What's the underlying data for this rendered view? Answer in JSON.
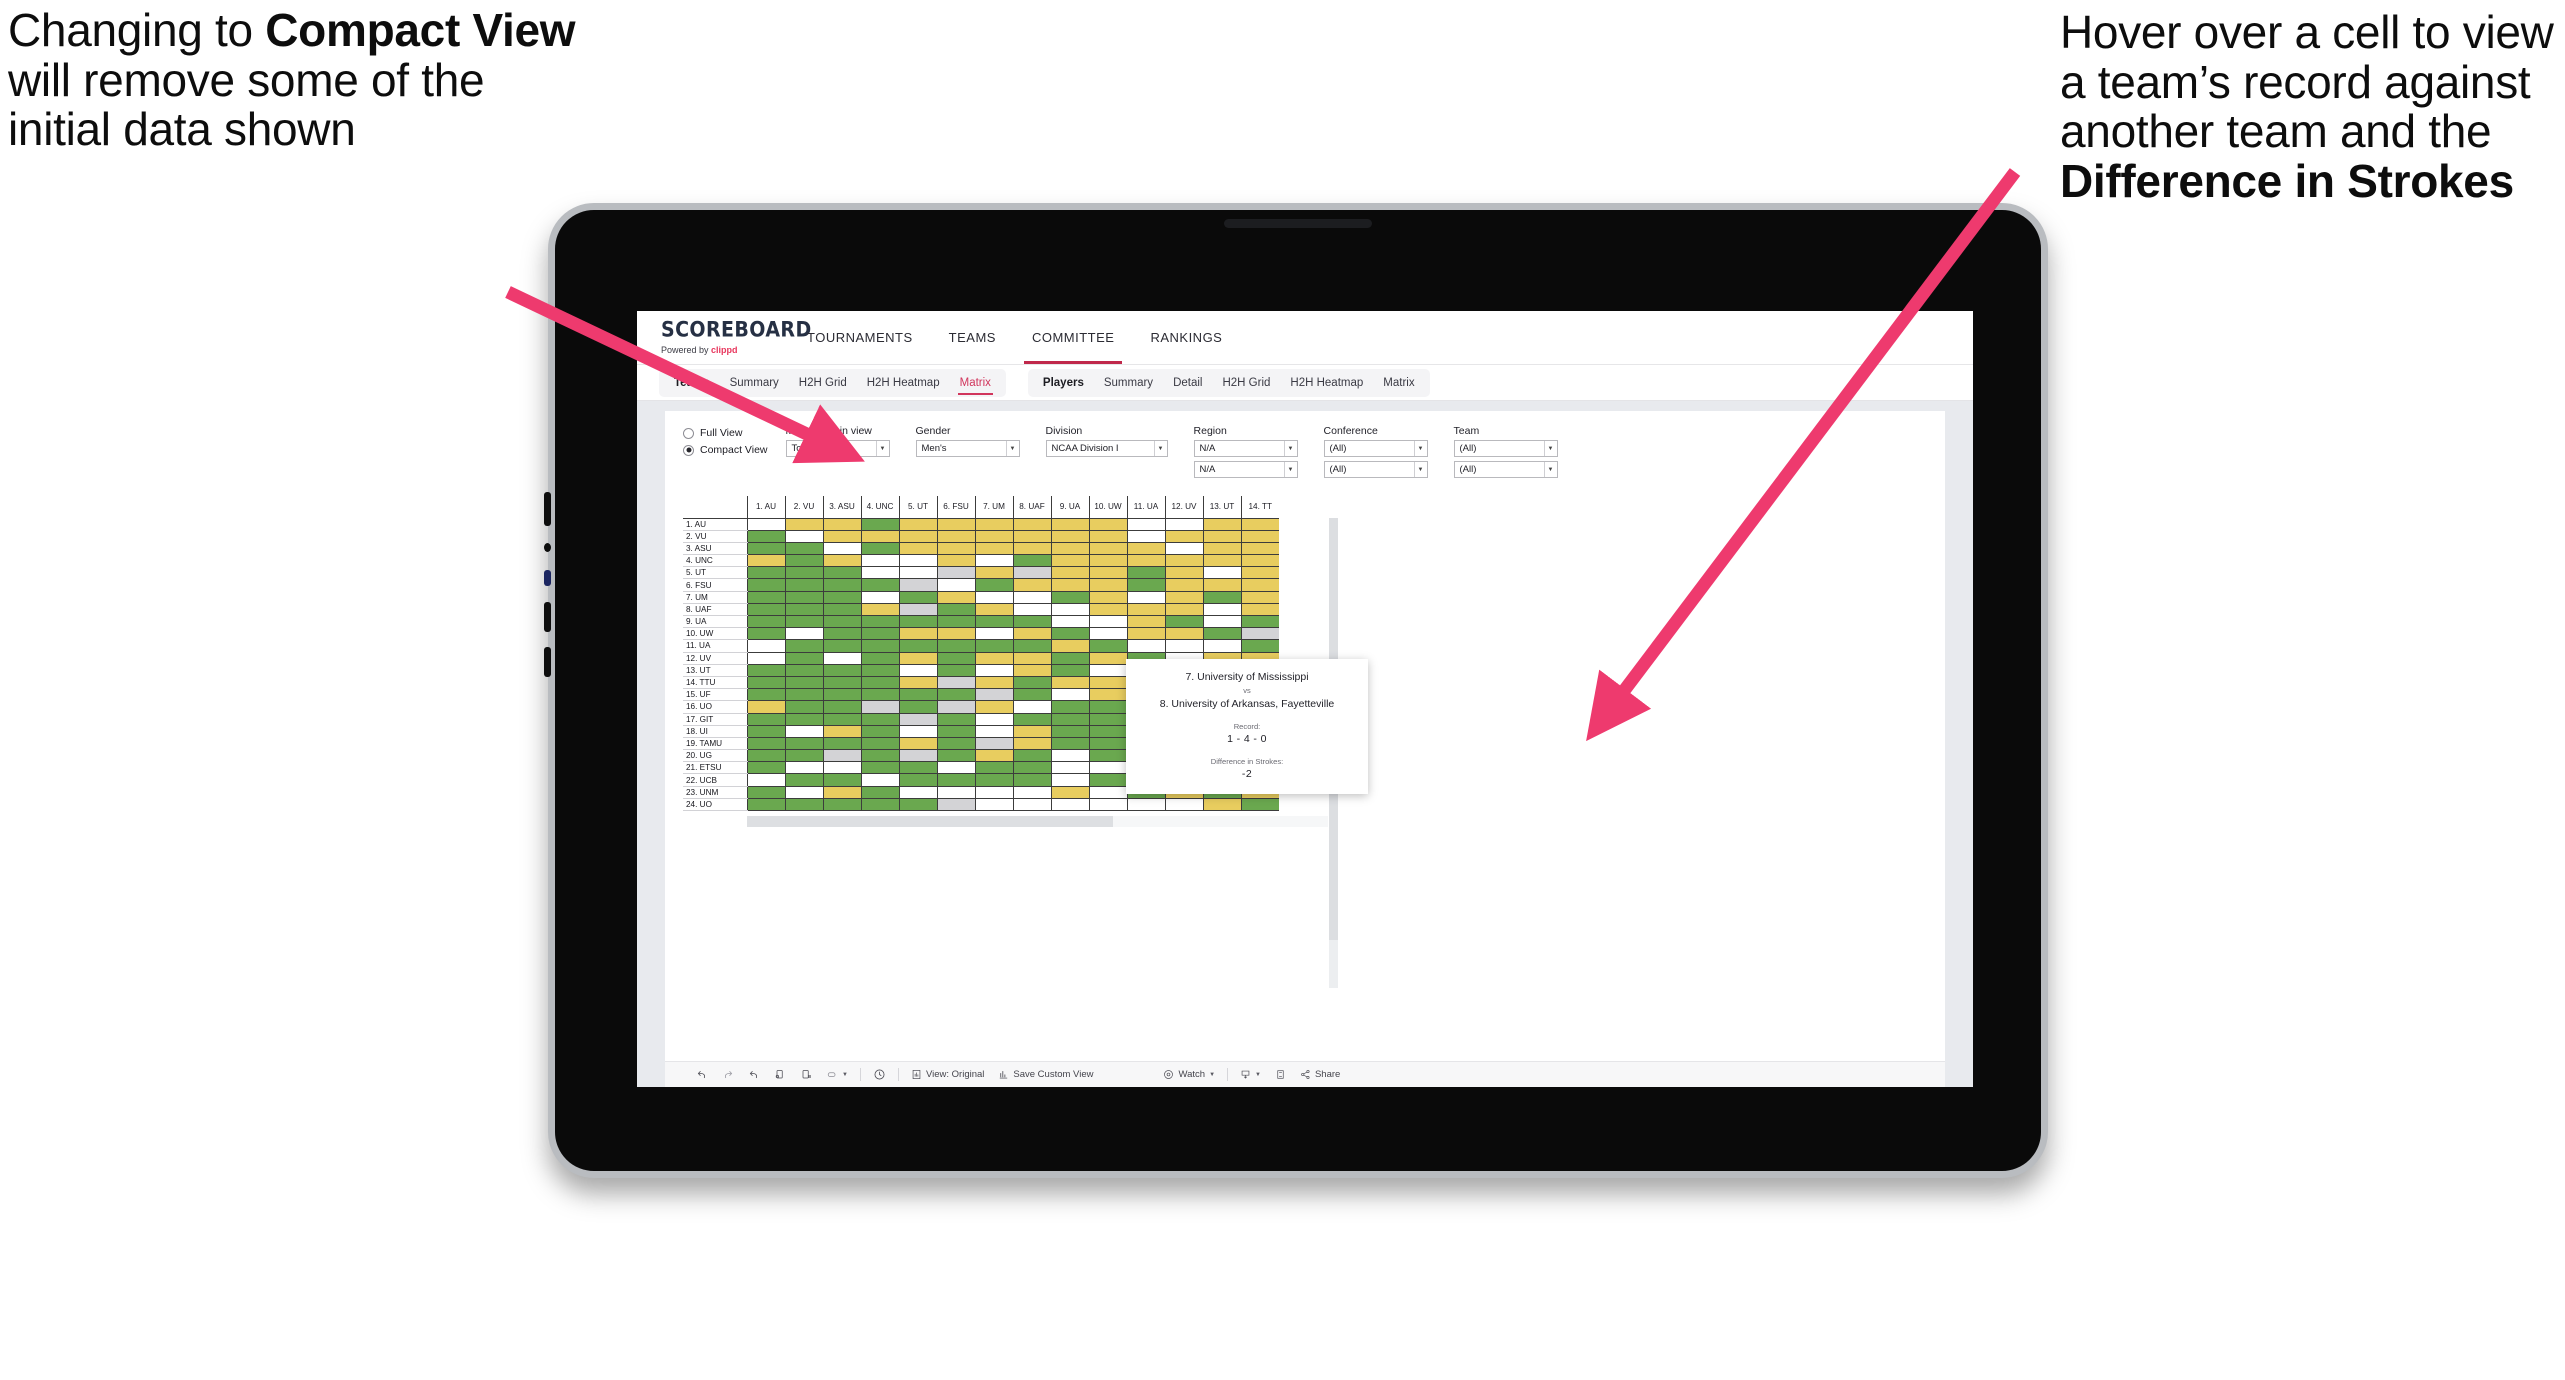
{
  "annotations": {
    "left": {
      "pre": "Changing to ",
      "bold": "Compact View",
      "post": " will remove some of the initial data shown"
    },
    "right": {
      "pre": "Hover over a cell to view a team’s record against another team and the ",
      "bold": "Difference in Strokes",
      "post": ""
    },
    "arrow_color": "#ee3a6e"
  },
  "app": {
    "logo": {
      "title": "SCOREBOARD",
      "powered_prefix": "Powered by ",
      "brand": "clippd"
    },
    "topnav": [
      {
        "label": "TOURNAMENTS",
        "active": false
      },
      {
        "label": "TEAMS",
        "active": false
      },
      {
        "label": "COMMITTEE",
        "active": true
      },
      {
        "label": "RANKINGS",
        "active": false
      }
    ],
    "subnav": {
      "teams_group": [
        {
          "label": "Teams",
          "head": true,
          "active": false
        },
        {
          "label": "Summary",
          "head": false,
          "active": false
        },
        {
          "label": "H2H Grid",
          "head": false,
          "active": false
        },
        {
          "label": "H2H Heatmap",
          "head": false,
          "active": false
        },
        {
          "label": "Matrix",
          "head": false,
          "active": true
        }
      ],
      "players_group": [
        {
          "label": "Players",
          "head": true,
          "active": false
        },
        {
          "label": "Summary",
          "head": false,
          "active": false
        },
        {
          "label": "Detail",
          "head": false,
          "active": false
        },
        {
          "label": "H2H Grid",
          "head": false,
          "active": false
        },
        {
          "label": "H2H Heatmap",
          "head": false,
          "active": false
        },
        {
          "label": "Matrix",
          "head": false,
          "active": false
        }
      ]
    },
    "filters": {
      "view_mode": {
        "full_label": "Full View",
        "compact_label": "Compact View",
        "selected": "Compact View"
      },
      "max_teams": {
        "label": "Max teams in view",
        "value": "Top 50"
      },
      "gender": {
        "label": "Gender",
        "value": "Men's"
      },
      "division": {
        "label": "Division",
        "value": "NCAA Division I"
      },
      "region": {
        "label": "Region",
        "value": "N/A",
        "value2": "N/A"
      },
      "conference": {
        "label": "Conference",
        "value": "(All)",
        "value2": "(All)"
      },
      "team": {
        "label": "Team",
        "value": "(All)",
        "value2": "(All)"
      }
    },
    "toolbar": {
      "undo": "undo-icon",
      "redo": "redo-icon",
      "revert": "revert-icon",
      "refresh": "refresh-icon",
      "pause": "pause-icon",
      "shape": "shape-icon",
      "clock": "clock-icon",
      "view_original": "View: Original",
      "save_custom_view": "Save Custom View",
      "watch": "Watch",
      "download": "download-icon",
      "fullscreen": "fullscreen-icon",
      "share": "Share"
    },
    "tooltip": {
      "team_a": "7. University of Mississippi",
      "vs": "vs",
      "team_b": "8. University of Arkansas, Fayetteville",
      "record_label": "Record:",
      "record_value": "1 - 4 - 0",
      "diff_label": "Difference in Strokes:",
      "diff_value": "-2"
    }
  },
  "matrix": {
    "colors": {
      "win": "#6aa84f",
      "loss": "#e8cd5f",
      "none": "#ffffff",
      "tie": "#d3d3d6"
    },
    "legend": {
      "win": "green",
      "loss": "yellow",
      "tie": "gray",
      "empty": "white"
    },
    "columns": [
      "1. AU",
      "2. VU",
      "3. ASU",
      "4. UNC",
      "5. UT",
      "6. FSU",
      "7. UM",
      "8. UAF",
      "9. UA",
      "10. UW",
      "11. UA",
      "12. UV",
      "13. UT",
      "14. TT"
    ],
    "rows": [
      "1. AU",
      "2. VU",
      "3. ASU",
      "4. UNC",
      "5. UT",
      "6. FSU",
      "7. UM",
      "8. UAF",
      "9. UA",
      "10. UW",
      "11. UA",
      "12. UV",
      "13. UT",
      "14. TTU",
      "15. UF",
      "16. UO",
      "17. GIT",
      "18. UI",
      "19. TAMU",
      "20. UG",
      "21. ETSU",
      "22. UCB",
      "23. UNM",
      "24. UO"
    ],
    "cells": [
      [
        "n",
        "y",
        "y",
        "g",
        "y",
        "y",
        "y",
        "y",
        "y",
        "y",
        "w",
        "w",
        "y",
        "y"
      ],
      [
        "g",
        "n",
        "y",
        "y",
        "y",
        "y",
        "y",
        "y",
        "y",
        "y",
        "w",
        "y",
        "y",
        "y"
      ],
      [
        "g",
        "g",
        "n",
        "g",
        "y",
        "y",
        "y",
        "y",
        "y",
        "y",
        "y",
        "w",
        "y",
        "y"
      ],
      [
        "y",
        "g",
        "y",
        "n",
        "w",
        "y",
        "w",
        "g",
        "y",
        "y",
        "y",
        "y",
        "y",
        "y"
      ],
      [
        "g",
        "g",
        "g",
        "w",
        "n",
        "a",
        "y",
        "a",
        "y",
        "y",
        "g",
        "y",
        "w",
        "y"
      ],
      [
        "g",
        "g",
        "g",
        "g",
        "a",
        "n",
        "g",
        "y",
        "y",
        "y",
        "g",
        "y",
        "y",
        "y"
      ],
      [
        "g",
        "g",
        "g",
        "w",
        "g",
        "y",
        "n",
        "w",
        "g",
        "y",
        "w",
        "y",
        "g",
        "y"
      ],
      [
        "g",
        "g",
        "g",
        "y",
        "a",
        "g",
        "y",
        "n",
        "w",
        "y",
        "y",
        "y",
        "w",
        "y"
      ],
      [
        "g",
        "g",
        "g",
        "g",
        "g",
        "g",
        "g",
        "g",
        "n",
        "w",
        "y",
        "g",
        "w",
        "g"
      ],
      [
        "g",
        "w",
        "g",
        "g",
        "y",
        "y",
        "w",
        "y",
        "g",
        "n",
        "y",
        "y",
        "g",
        "a"
      ],
      [
        "w",
        "g",
        "g",
        "g",
        "g",
        "g",
        "g",
        "g",
        "y",
        "g",
        "n",
        "w",
        "w",
        "g"
      ],
      [
        "w",
        "g",
        "w",
        "g",
        "y",
        "g",
        "y",
        "y",
        "g",
        "y",
        "g",
        "n",
        "y",
        "y"
      ],
      [
        "g",
        "g",
        "g",
        "g",
        "w",
        "g",
        "w",
        "y",
        "g",
        "w",
        "g",
        "w",
        "n",
        "w"
      ],
      [
        "g",
        "g",
        "g",
        "g",
        "y",
        "a",
        "y",
        "g",
        "y",
        "y",
        "g",
        "y",
        "y",
        "n"
      ],
      [
        "g",
        "g",
        "g",
        "g",
        "g",
        "g",
        "a",
        "g",
        "w",
        "y",
        "g",
        "g",
        "w",
        "w"
      ],
      [
        "y",
        "g",
        "g",
        "a",
        "g",
        "a",
        "y",
        "w",
        "g",
        "g",
        "w",
        "y",
        "w",
        "y"
      ],
      [
        "g",
        "g",
        "g",
        "g",
        "a",
        "g",
        "w",
        "g",
        "g",
        "g",
        "g",
        "w",
        "w",
        "g"
      ],
      [
        "g",
        "w",
        "y",
        "g",
        "w",
        "g",
        "w",
        "y",
        "g",
        "g",
        "y",
        "g",
        "w",
        "y"
      ],
      [
        "g",
        "g",
        "g",
        "g",
        "y",
        "g",
        "a",
        "y",
        "g",
        "g",
        "w",
        "g",
        "y",
        "y"
      ],
      [
        "g",
        "g",
        "a",
        "g",
        "a",
        "g",
        "y",
        "g",
        "w",
        "g",
        "w",
        "y",
        "w",
        "a"
      ],
      [
        "g",
        "w",
        "w",
        "g",
        "g",
        "w",
        "g",
        "g",
        "w",
        "w",
        "g",
        "g",
        "g",
        "y"
      ],
      [
        "w",
        "g",
        "g",
        "w",
        "g",
        "g",
        "g",
        "g",
        "w",
        "g",
        "y",
        "w",
        "y",
        "g"
      ],
      [
        "g",
        "w",
        "y",
        "g",
        "w",
        "w",
        "w",
        "w",
        "y",
        "w",
        "g",
        "y",
        "g",
        "y"
      ],
      [
        "g",
        "g",
        "g",
        "g",
        "g",
        "a",
        "w",
        "w",
        "w",
        "w",
        "w",
        "w",
        "y",
        "g"
      ]
    ]
  }
}
